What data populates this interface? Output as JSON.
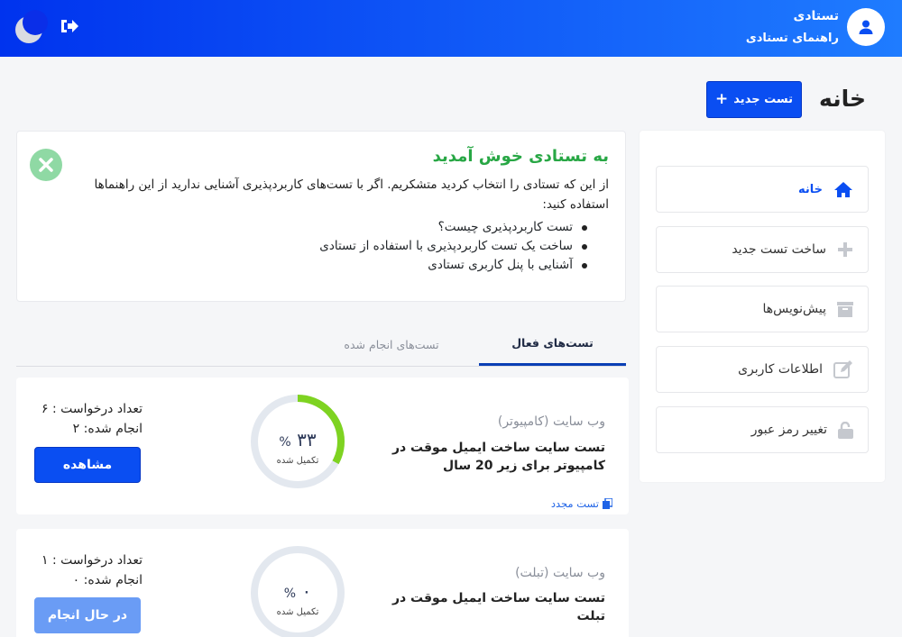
{
  "header": {
    "user_name": "تستادی",
    "user_role": "راهنمای تستادی",
    "colors": {
      "gradient_start": "#0033ee",
      "gradient_end": "#1f7cff"
    },
    "icons": {
      "avatar": "user-icon",
      "logout": "logout-icon",
      "theme": "moon-icon"
    }
  },
  "page": {
    "title": "خانه",
    "new_test_label": "تست جدید",
    "new_test_icon": "plus-icon"
  },
  "sidebar": {
    "items": [
      {
        "label": "خانه",
        "icon": "home-icon",
        "active": true
      },
      {
        "label": "ساخت تست جدید",
        "icon": "plus-icon",
        "active": false
      },
      {
        "label": "پیش‌نویس‌ها",
        "icon": "archive-icon",
        "active": false
      },
      {
        "label": "اطلاعات کاربری",
        "icon": "edit-icon",
        "active": false
      },
      {
        "label": "تغییر رمز عبور",
        "icon": "lock-icon",
        "active": false
      }
    ]
  },
  "welcome": {
    "title": "به تستادی خوش آمدید",
    "body": "از این که تستادی را انتخاب کردید متشکریم. اگر با تست‌های کاربردپذیری آشنایی ندارید از این راهنماها استفاده کنید:",
    "items": [
      "تست کاربردپذیری چیست؟",
      "ساخت یک تست کاربردپذیری با استفاده از تستادی",
      "آشنایی با پنل کاربری تستادی"
    ]
  },
  "tabs": {
    "active": "تست‌های فعال",
    "done": "تست‌های انجام شده"
  },
  "tests": [
    {
      "category": "وب سایت (کامپیوتر)",
      "description": "تست سایت ساخت ایمیل موقت در کامپیوتر برای زیر 20 سال",
      "progress_value": "۳۳",
      "progress_fraction": 0.33,
      "percent_sign": "%",
      "progress_label": "تکمیل شده",
      "requests": "تعداد درخواست : ۶",
      "done": "انجام شده: ۲",
      "button_label": "مشاهده",
      "retest_label": "تست مجدد"
    },
    {
      "category": "وب سایت (تبلت)",
      "description": "تست سایت ساخت ایمیل موقت در تبلت",
      "progress_value": "۰",
      "progress_fraction": 0,
      "percent_sign": "%",
      "progress_label": "تکمیل شده",
      "requests": "تعداد درخواست : ۱",
      "done": "انجام شده: ۰",
      "button_label": "در حال انجام"
    }
  ]
}
